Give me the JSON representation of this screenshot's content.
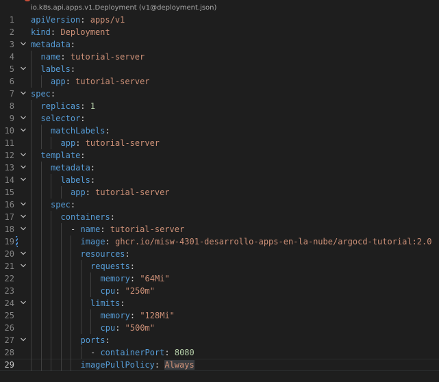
{
  "breadcrumb": "io.k8s.api.apps.v1.Deployment (v1@deployment.json)",
  "lines": [
    {
      "n": "1",
      "key": "apiVersion",
      "value": "apps/v1",
      "vt": "s"
    },
    {
      "n": "2",
      "key": "kind",
      "value": "Deployment",
      "vt": "s"
    },
    {
      "n": "3",
      "key": "metadata",
      "fold": true
    },
    {
      "n": "4",
      "key": "name",
      "value": "tutorial-server",
      "vt": "s"
    },
    {
      "n": "5",
      "key": "labels",
      "fold": true
    },
    {
      "n": "6",
      "key": "app",
      "value": "tutorial-server",
      "vt": "s"
    },
    {
      "n": "7",
      "key": "spec",
      "fold": true
    },
    {
      "n": "8",
      "key": "replicas",
      "value": "1",
      "vt": "n"
    },
    {
      "n": "9",
      "key": "selector",
      "fold": true
    },
    {
      "n": "10",
      "key": "matchLabels",
      "fold": true
    },
    {
      "n": "11",
      "key": "app",
      "value": "tutorial-server",
      "vt": "s"
    },
    {
      "n": "12",
      "key": "template",
      "fold": true
    },
    {
      "n": "13",
      "key": "metadata",
      "fold": true
    },
    {
      "n": "14",
      "key": "labels",
      "fold": true
    },
    {
      "n": "15",
      "key": "app",
      "value": "tutorial-server",
      "vt": "s"
    },
    {
      "n": "16",
      "key": "spec",
      "fold": true
    },
    {
      "n": "17",
      "key": "containers",
      "fold": true
    },
    {
      "n": "18",
      "dash": "- ",
      "key": "name",
      "value": "tutorial-server",
      "vt": "s",
      "fold": true
    },
    {
      "n": "19",
      "key": "image",
      "value": "ghcr.io/misw-4301-desarrollo-apps-en-la-nube/argocd-tutorial:2.0",
      "vt": "s",
      "modified": true
    },
    {
      "n": "20",
      "key": "resources",
      "fold": true
    },
    {
      "n": "21",
      "key": "requests",
      "fold": true
    },
    {
      "n": "22",
      "key": "memory",
      "value": "\"64Mi\"",
      "vt": "s"
    },
    {
      "n": "23",
      "key": "cpu",
      "value": "\"250m\"",
      "vt": "s"
    },
    {
      "n": "24",
      "key": "limits",
      "fold": true
    },
    {
      "n": "25",
      "key": "memory",
      "value": "\"128Mi\"",
      "vt": "s"
    },
    {
      "n": "26",
      "key": "cpu",
      "value": "\"500m\"",
      "vt": "s"
    },
    {
      "n": "27",
      "key": "ports",
      "fold": true
    },
    {
      "n": "28",
      "dash": "- ",
      "key": "containerPort",
      "value": "8080",
      "vt": "n"
    },
    {
      "n": "29",
      "key": "imagePullPolicy",
      "value": "Always",
      "vt": "sel",
      "current": true
    }
  ],
  "colors": {
    "background": "#1e1e1e",
    "key": "#569cd6",
    "string": "#ce9178",
    "number": "#b5cea8",
    "line_number": "#858585"
  }
}
